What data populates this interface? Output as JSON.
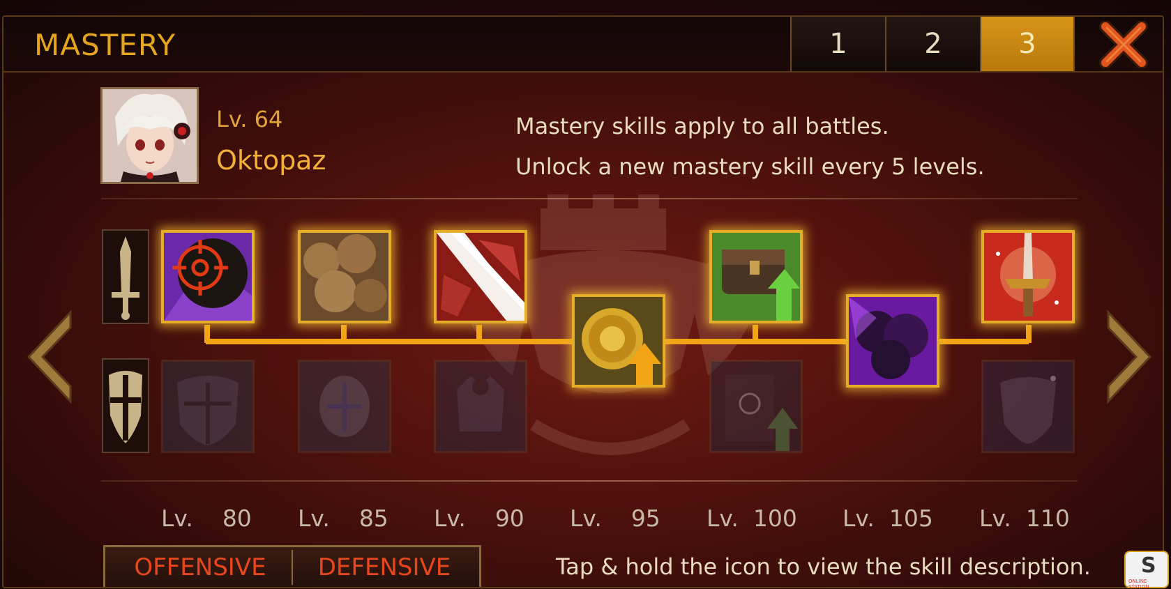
{
  "header": {
    "title": "MASTERY",
    "tabs": [
      {
        "label": "1",
        "active": false
      },
      {
        "label": "2",
        "active": false
      },
      {
        "label": "3",
        "active": true
      }
    ],
    "close_icon": "close-x-icon"
  },
  "hero": {
    "level": "Lv. 64",
    "name": "Oktopaz"
  },
  "info": {
    "line1": "Mastery skills apply to all battles.",
    "line2": "Unlock a new mastery skill every 5 levels."
  },
  "rows": {
    "offensive_icon": "sword-icon",
    "defensive_icon": "shield-icon"
  },
  "skills": [
    {
      "level_prefix": "Lv.",
      "level": "80",
      "offensive_selected": true,
      "defensive_selected": false,
      "icon": "target-icon"
    },
    {
      "level_prefix": "Lv.",
      "level": "85",
      "offensive_selected": true,
      "defensive_selected": false,
      "icon": "smoke-icon"
    },
    {
      "level_prefix": "Lv.",
      "level": "90",
      "offensive_selected": true,
      "defensive_selected": false,
      "icon": "blade-icon"
    },
    {
      "level_prefix": "Lv.",
      "level": "95",
      "single": true,
      "icon": "gold-coin-up-icon"
    },
    {
      "level_prefix": "Lv.",
      "level": "100",
      "offensive_selected": true,
      "defensive_selected": false,
      "icon": "treasure-chest-up-icon"
    },
    {
      "level_prefix": "Lv.",
      "level": "105",
      "single": true,
      "icon": "dark-aura-icon"
    },
    {
      "level_prefix": "Lv.",
      "level": "110",
      "offensive_selected": true,
      "defensive_selected": false,
      "icon": "holy-sword-icon"
    }
  ],
  "bottom": {
    "offensive_label": "OFFENSIVE",
    "defensive_label": "DEFENSIVE",
    "hint": "Tap & hold the icon to view the skill description."
  },
  "watermark": {
    "letter": "S",
    "text": "ONLINE STATION"
  },
  "colors": {
    "accent": "#e6a51f",
    "active_tab": "#d79418",
    "connector": "#f3a414",
    "toggle_text": "#e8471c"
  }
}
